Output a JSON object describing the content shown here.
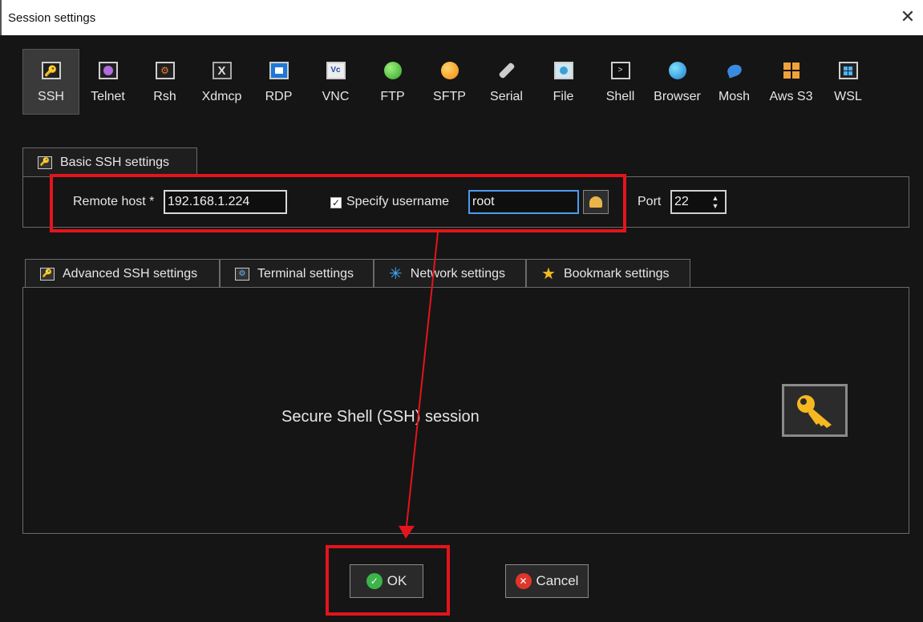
{
  "window": {
    "title": "Session settings",
    "close_label": "✕"
  },
  "protocols": [
    {
      "label": "SSH",
      "icon": "ssh-key-icon",
      "active": true
    },
    {
      "label": "Telnet",
      "icon": "telnet-icon"
    },
    {
      "label": "Rsh",
      "icon": "rsh-icon"
    },
    {
      "label": "Xdmcp",
      "icon": "xdmcp-icon"
    },
    {
      "label": "RDP",
      "icon": "rdp-icon"
    },
    {
      "label": "VNC",
      "icon": "vnc-icon"
    },
    {
      "label": "FTP",
      "icon": "ftp-globe-icon"
    },
    {
      "label": "SFTP",
      "icon": "sftp-globe-icon"
    },
    {
      "label": "Serial",
      "icon": "serial-plug-icon"
    },
    {
      "label": "File",
      "icon": "file-icon"
    },
    {
      "label": "Shell",
      "icon": "shell-icon"
    },
    {
      "label": "Browser",
      "icon": "browser-globe-icon"
    },
    {
      "label": "Mosh",
      "icon": "mosh-satellite-icon"
    },
    {
      "label": "Aws S3",
      "icon": "aws-s3-icon"
    },
    {
      "label": "WSL",
      "icon": "wsl-windows-icon"
    }
  ],
  "basic": {
    "tab_label": "Basic SSH settings",
    "remote_host_label": "Remote host *",
    "remote_host_value": "192.168.1.224",
    "specify_username_label": "Specify username",
    "specify_username_checked": true,
    "username_value": "root",
    "port_label": "Port",
    "port_value": "22"
  },
  "tabs": [
    {
      "label": "Advanced SSH settings",
      "icon": "key-icon"
    },
    {
      "label": "Terminal settings",
      "icon": "terminal-icon"
    },
    {
      "label": "Network settings",
      "icon": "network-icon"
    },
    {
      "label": "Bookmark settings",
      "icon": "star-icon"
    }
  ],
  "content": {
    "description": "Secure Shell (SSH) session"
  },
  "buttons": {
    "ok_label": "OK",
    "cancel_label": "Cancel"
  },
  "colors": {
    "highlight": "#e4141c",
    "ok_green": "#3cb44a",
    "cancel_red": "#e0352b",
    "accent_focus": "#4a9cf0"
  }
}
